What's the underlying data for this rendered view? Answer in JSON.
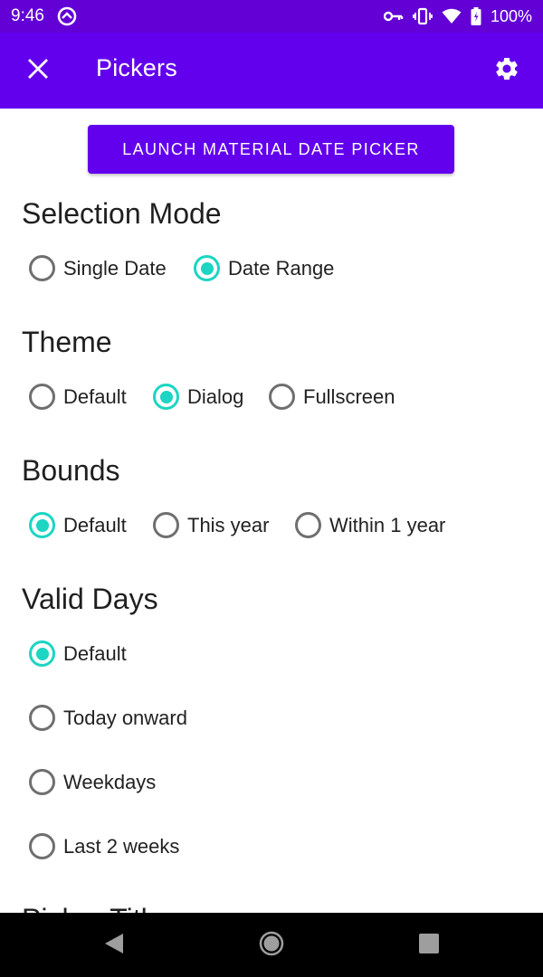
{
  "status_bar": {
    "time": "9:46",
    "battery": "100%"
  },
  "app_bar": {
    "title": "Pickers",
    "close_icon": "close-icon",
    "settings_icon": "gear-icon"
  },
  "launch_button": {
    "label": "LAUNCH MATERIAL DATE PICKER"
  },
  "sections": {
    "selection_mode": {
      "title": "Selection Mode",
      "options": [
        "Single Date",
        "Date Range"
      ],
      "selected": "Date Range"
    },
    "theme": {
      "title": "Theme",
      "options": [
        "Default",
        "Dialog",
        "Fullscreen"
      ],
      "selected": "Dialog"
    },
    "bounds": {
      "title": "Bounds",
      "options": [
        "Default",
        "This year",
        "Within 1 year"
      ],
      "selected": "Default"
    },
    "valid_days": {
      "title": "Valid Days",
      "options": [
        "Default",
        "Today onward",
        "Weekdays",
        "Last 2 weeks"
      ],
      "selected": "Default"
    },
    "picker_title": {
      "title": "Picker Title"
    }
  },
  "colors": {
    "primary": "#6200ee",
    "status_bar": "#6200d6",
    "accent": "#1cd5c2"
  }
}
